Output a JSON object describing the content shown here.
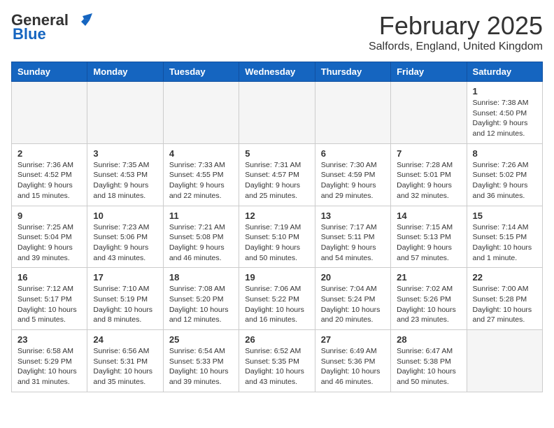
{
  "header": {
    "logo_general": "General",
    "logo_blue": "Blue",
    "month_title": "February 2025",
    "location": "Salfords, England, United Kingdom"
  },
  "days_of_week": [
    "Sunday",
    "Monday",
    "Tuesday",
    "Wednesday",
    "Thursday",
    "Friday",
    "Saturday"
  ],
  "weeks": [
    [
      {
        "day": "",
        "info": ""
      },
      {
        "day": "",
        "info": ""
      },
      {
        "day": "",
        "info": ""
      },
      {
        "day": "",
        "info": ""
      },
      {
        "day": "",
        "info": ""
      },
      {
        "day": "",
        "info": ""
      },
      {
        "day": "1",
        "info": "Sunrise: 7:38 AM\nSunset: 4:50 PM\nDaylight: 9 hours and 12 minutes."
      }
    ],
    [
      {
        "day": "2",
        "info": "Sunrise: 7:36 AM\nSunset: 4:52 PM\nDaylight: 9 hours and 15 minutes."
      },
      {
        "day": "3",
        "info": "Sunrise: 7:35 AM\nSunset: 4:53 PM\nDaylight: 9 hours and 18 minutes."
      },
      {
        "day": "4",
        "info": "Sunrise: 7:33 AM\nSunset: 4:55 PM\nDaylight: 9 hours and 22 minutes."
      },
      {
        "day": "5",
        "info": "Sunrise: 7:31 AM\nSunset: 4:57 PM\nDaylight: 9 hours and 25 minutes."
      },
      {
        "day": "6",
        "info": "Sunrise: 7:30 AM\nSunset: 4:59 PM\nDaylight: 9 hours and 29 minutes."
      },
      {
        "day": "7",
        "info": "Sunrise: 7:28 AM\nSunset: 5:01 PM\nDaylight: 9 hours and 32 minutes."
      },
      {
        "day": "8",
        "info": "Sunrise: 7:26 AM\nSunset: 5:02 PM\nDaylight: 9 hours and 36 minutes."
      }
    ],
    [
      {
        "day": "9",
        "info": "Sunrise: 7:25 AM\nSunset: 5:04 PM\nDaylight: 9 hours and 39 minutes."
      },
      {
        "day": "10",
        "info": "Sunrise: 7:23 AM\nSunset: 5:06 PM\nDaylight: 9 hours and 43 minutes."
      },
      {
        "day": "11",
        "info": "Sunrise: 7:21 AM\nSunset: 5:08 PM\nDaylight: 9 hours and 46 minutes."
      },
      {
        "day": "12",
        "info": "Sunrise: 7:19 AM\nSunset: 5:10 PM\nDaylight: 9 hours and 50 minutes."
      },
      {
        "day": "13",
        "info": "Sunrise: 7:17 AM\nSunset: 5:11 PM\nDaylight: 9 hours and 54 minutes."
      },
      {
        "day": "14",
        "info": "Sunrise: 7:15 AM\nSunset: 5:13 PM\nDaylight: 9 hours and 57 minutes."
      },
      {
        "day": "15",
        "info": "Sunrise: 7:14 AM\nSunset: 5:15 PM\nDaylight: 10 hours and 1 minute."
      }
    ],
    [
      {
        "day": "16",
        "info": "Sunrise: 7:12 AM\nSunset: 5:17 PM\nDaylight: 10 hours and 5 minutes."
      },
      {
        "day": "17",
        "info": "Sunrise: 7:10 AM\nSunset: 5:19 PM\nDaylight: 10 hours and 8 minutes."
      },
      {
        "day": "18",
        "info": "Sunrise: 7:08 AM\nSunset: 5:20 PM\nDaylight: 10 hours and 12 minutes."
      },
      {
        "day": "19",
        "info": "Sunrise: 7:06 AM\nSunset: 5:22 PM\nDaylight: 10 hours and 16 minutes."
      },
      {
        "day": "20",
        "info": "Sunrise: 7:04 AM\nSunset: 5:24 PM\nDaylight: 10 hours and 20 minutes."
      },
      {
        "day": "21",
        "info": "Sunrise: 7:02 AM\nSunset: 5:26 PM\nDaylight: 10 hours and 23 minutes."
      },
      {
        "day": "22",
        "info": "Sunrise: 7:00 AM\nSunset: 5:28 PM\nDaylight: 10 hours and 27 minutes."
      }
    ],
    [
      {
        "day": "23",
        "info": "Sunrise: 6:58 AM\nSunset: 5:29 PM\nDaylight: 10 hours and 31 minutes."
      },
      {
        "day": "24",
        "info": "Sunrise: 6:56 AM\nSunset: 5:31 PM\nDaylight: 10 hours and 35 minutes."
      },
      {
        "day": "25",
        "info": "Sunrise: 6:54 AM\nSunset: 5:33 PM\nDaylight: 10 hours and 39 minutes."
      },
      {
        "day": "26",
        "info": "Sunrise: 6:52 AM\nSunset: 5:35 PM\nDaylight: 10 hours and 43 minutes."
      },
      {
        "day": "27",
        "info": "Sunrise: 6:49 AM\nSunset: 5:36 PM\nDaylight: 10 hours and 46 minutes."
      },
      {
        "day": "28",
        "info": "Sunrise: 6:47 AM\nSunset: 5:38 PM\nDaylight: 10 hours and 50 minutes."
      },
      {
        "day": "",
        "info": ""
      }
    ]
  ]
}
